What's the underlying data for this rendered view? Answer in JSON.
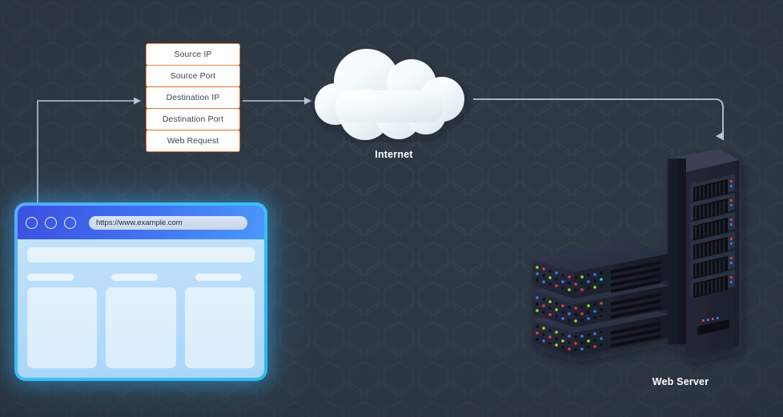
{
  "diagram": {
    "title": "Web request flow from browser through Internet to web server",
    "background_color": "#2e3845",
    "accent_color": "#e8702a",
    "line_color": "#b9c4cf"
  },
  "packet": {
    "name": "network-packet",
    "border_color": "#e8702a",
    "fields": [
      {
        "label": "Source IP"
      },
      {
        "label": "Source Port"
      },
      {
        "label": "Destination IP"
      },
      {
        "label": "Destination Port"
      },
      {
        "label": "Web Request"
      }
    ]
  },
  "cloud": {
    "label": "Internet",
    "icon": "cloud-icon",
    "color": "#f2f7fa"
  },
  "browser": {
    "icon": "browser-window-icon",
    "traffic_lights": [
      {
        "name": "close-dot"
      },
      {
        "name": "minimize-dot"
      },
      {
        "name": "maximize-dot"
      }
    ],
    "url": "https://www.example.com",
    "url_placeholder": "https://www.example.com",
    "titlebar_color": "#3f6ef0",
    "glow_color": "#35c3f5",
    "content": {
      "banner": "",
      "sub_bars": [
        "",
        "",
        ""
      ],
      "cards": [
        "",
        "",
        ""
      ]
    }
  },
  "server": {
    "label": "Web Server",
    "icon": "server-rack-icon",
    "rack_bays": 6,
    "stacked_units": 3,
    "led_colors": [
      "#e23b3b",
      "#3b7ae2",
      "#9ede2b",
      "#2bd4de"
    ]
  },
  "connections": [
    {
      "name": "browser-to-packet",
      "from": "browser",
      "to": "packet",
      "arrow": "right"
    },
    {
      "name": "packet-to-internet",
      "from": "packet",
      "to": "cloud",
      "arrow": "right"
    },
    {
      "name": "internet-to-server",
      "from": "cloud",
      "to": "server",
      "arrow": "down"
    }
  ]
}
